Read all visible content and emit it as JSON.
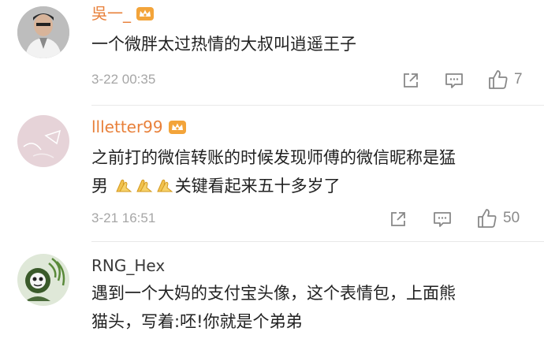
{
  "comments": [
    {
      "username": "吳一_",
      "username_color": "#e8803a",
      "text_lines": [
        "一个微胖太过热情的大叔叫逍遥王子"
      ],
      "timestamp": "3-22 00:35",
      "likes": "7",
      "vip": true,
      "avatar_icon": "person-photo-icon"
    },
    {
      "username": "llletter99",
      "username_color": "#e8803a",
      "text_lines": [
        "之前打的微信转账的时候发现师傅的微信昵称是猛",
        "关键看起来五十多岁了"
      ],
      "emoji_prefix_line2": "praying-hands-emoji",
      "emoji_count": 3,
      "line2_start": "男",
      "timestamp": "3-21 16:51",
      "likes": "50",
      "vip": true,
      "avatar_icon": "pink-pastel-avatar-icon"
    },
    {
      "username": "RNG_Hex",
      "username_color": "#3a3a3a",
      "text_lines": [
        "遇到一个大妈的支付宝头像，这个表情包，上面熊",
        "猫头，写着:呸!你就是个弟弟"
      ],
      "vip": false,
      "avatar_icon": "panda-meme-avatar-icon"
    }
  ],
  "icons": {
    "share": "share-icon",
    "reply": "comment-icon",
    "like": "thumbs-up-icon",
    "vip": "vip-crown-badge-icon"
  },
  "colors": {
    "muted": "#a6a6a6",
    "accent": "#e8803a",
    "divider": "#e8e8e8"
  }
}
